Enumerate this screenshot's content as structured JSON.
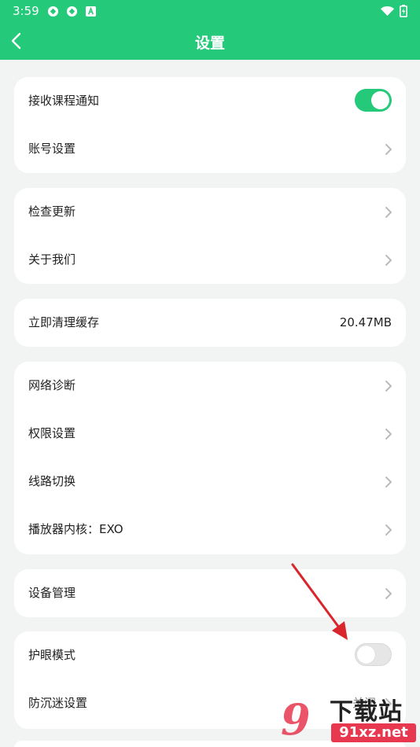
{
  "status_bar": {
    "time": "3:59",
    "icons": [
      "sync-icon",
      "sync-icon",
      "font-a-icon",
      "wifi-icon",
      "battery-icon"
    ]
  },
  "app_bar": {
    "title": "设置",
    "back_icon": "chevron-left-icon"
  },
  "colors": {
    "accent": "#24c97a",
    "background": "#f1f4f3",
    "card": "#ffffff",
    "annotation_arrow": "#d9262c"
  },
  "settings": {
    "course_notify": {
      "label": "接收课程通知",
      "toggle_on": true
    },
    "account": {
      "label": "账号设置"
    },
    "check_update": {
      "label": "检查更新"
    },
    "about": {
      "label": "关于我们"
    },
    "clear_cache": {
      "label": "立即清理缓存",
      "value": "20.47MB"
    },
    "network": {
      "label": "网络诊断"
    },
    "permissions": {
      "label": "权限设置"
    },
    "route_switch": {
      "label": "线路切换"
    },
    "player_core": {
      "label": "播放器内核：EXO"
    },
    "device_manage": {
      "label": "设备管理"
    },
    "eye_care": {
      "label": "护眼模式",
      "toggle_on": false
    },
    "anti_addiction": {
      "label": "防沉迷设置",
      "value": "关闭"
    }
  },
  "watermark": {
    "logo": "9",
    "text": "下载站",
    "url": "91xz.net"
  }
}
